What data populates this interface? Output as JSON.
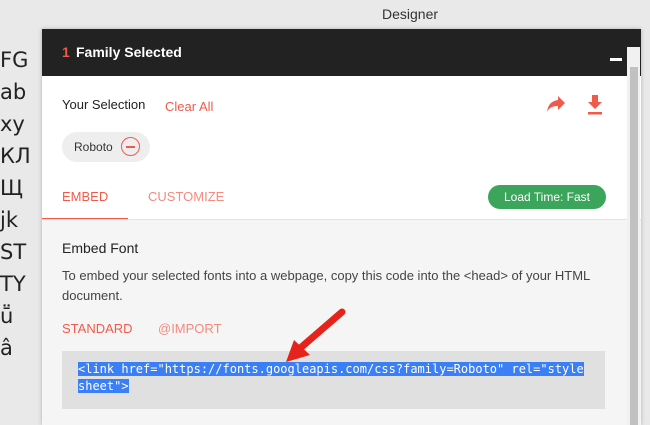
{
  "background": {
    "header_label": "Designer",
    "specimen_rows": [
      "FG",
      "ab",
      "xy",
      "КЛ",
      "Щ",
      "jk",
      "ST",
      "TY",
      "ṻ",
      "â"
    ]
  },
  "panel": {
    "count": "1",
    "title": "Family Selected",
    "selection_title": "Your Selection",
    "clear_all": "Clear All",
    "chip_label": "Roboto",
    "tabs": {
      "embed": "EMBED",
      "customize": "CUSTOMIZE"
    },
    "load_time": "Load Time: Fast",
    "embed_title": "Embed Font",
    "embed_desc": "To embed your selected fonts into a webpage, copy this code into the <head> of your HTML document.",
    "options": {
      "standard": "STANDARD",
      "import": "@IMPORT"
    },
    "code_line1": "<link href=\"https://fonts.googleapis.com/css?family=Roboto\" rel=\"style",
    "code_line2": "sheet\">"
  },
  "icons": {
    "share": "share-icon",
    "download": "download-icon",
    "remove": "remove-circle-icon",
    "arrow": "red-annotation-arrow"
  },
  "colors": {
    "accent": "#f15a4b",
    "badge": "#3ba55c",
    "header": "#222222",
    "selection": "#3a7ff5"
  }
}
